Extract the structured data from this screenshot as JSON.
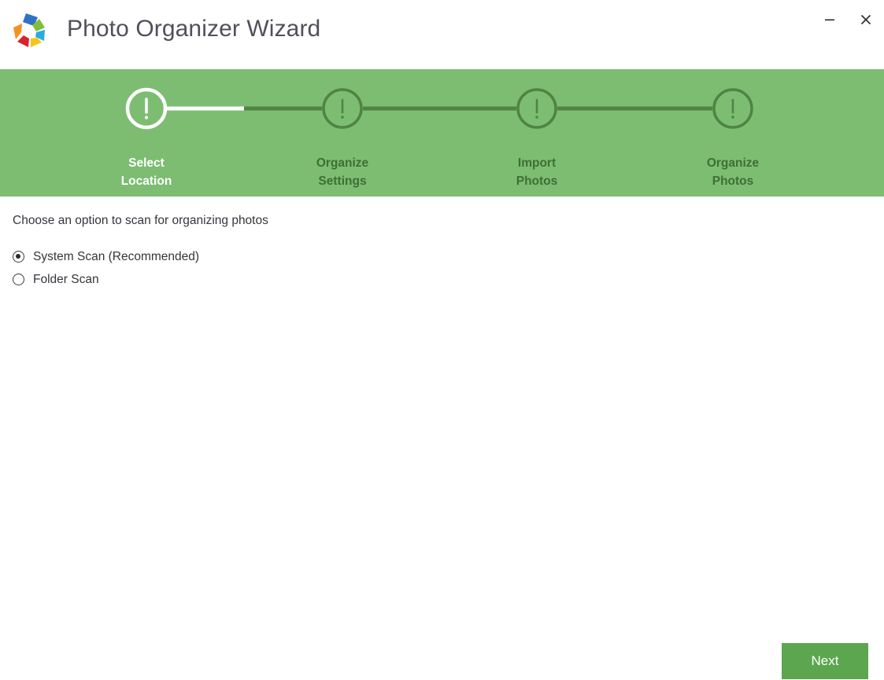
{
  "window": {
    "title": "Photo Organizer Wizard",
    "logo_icon": "hexagon-photo-logo",
    "controls": [
      {
        "name": "minimize-button",
        "icon": "minimize-icon",
        "label": "—"
      },
      {
        "name": "close-button",
        "icon": "close-icon",
        "label": "✕"
      }
    ]
  },
  "colors": {
    "stepper_background": "#7cbd72",
    "stepper_active": "#ffffff",
    "stepper_pending": "#3f6e35",
    "next_button": "#5ba64f",
    "title_text": "#50505c",
    "body_text": "#35353c"
  },
  "stepper": {
    "current_index": 0,
    "steps": [
      {
        "line1": "Select",
        "line2": "Location",
        "state": "active",
        "icon": "exclamation-circle-icon"
      },
      {
        "line1": "Organize",
        "line2": "Settings",
        "state": "pending",
        "icon": "exclamation-circle-icon"
      },
      {
        "line1": "Import",
        "line2": "Photos",
        "state": "pending",
        "icon": "exclamation-circle-icon"
      },
      {
        "line1": "Organize",
        "line2": "Photos",
        "state": "pending",
        "icon": "exclamation-circle-icon"
      }
    ]
  },
  "main": {
    "instruction": "Choose an option to scan for organizing photos",
    "scan_options": [
      {
        "label": "System Scan (Recommended)",
        "selected": true
      },
      {
        "label": "Folder Scan",
        "selected": false
      }
    ]
  },
  "footer": {
    "next_label": "Next"
  }
}
